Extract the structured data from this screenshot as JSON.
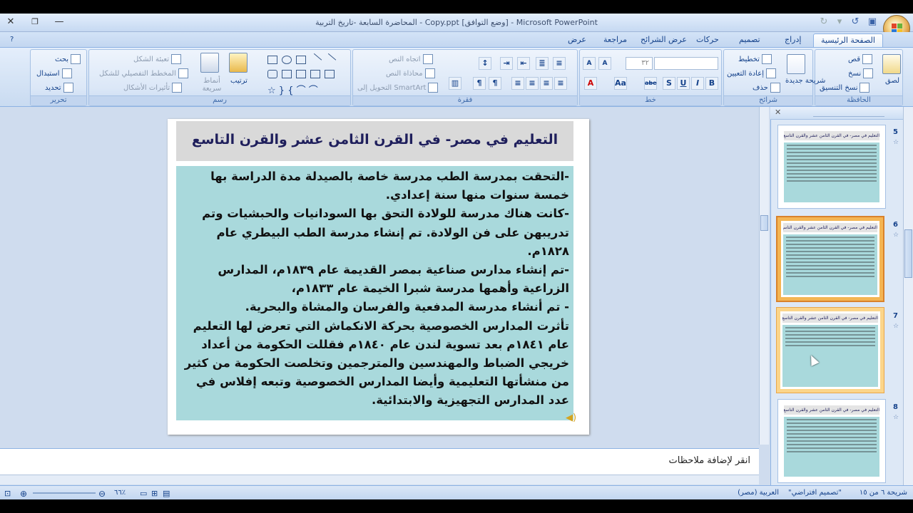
{
  "window": {
    "title": "المحاضرة السابعة -تاريخ التربية - Copy.ppt  [وضع التوافق] - Microsoft PowerPoint",
    "close": "✕",
    "restore": "❐",
    "minimize": "—"
  },
  "tabs": [
    "الصفحة الرئيسية",
    "إدراج",
    "تصميم",
    "حركات",
    "عرض الشرائح",
    "مراجعة",
    "عرض"
  ],
  "groups": {
    "clipboard": {
      "label": "الحافظة",
      "paste": "لصق",
      "cut": "قص",
      "copy": "نسخ",
      "format_painter": "نسخ التنسيق"
    },
    "slides": {
      "label": "شرائح",
      "new_slide": "شريحة جديدة",
      "layout": "تخطيط",
      "reset": "إعادة التعيين",
      "delete": "حذف"
    },
    "font": {
      "label": "خط",
      "size": "٣٢",
      "bold": "B",
      "italic": "I",
      "underline": "U",
      "shadow": "S",
      "strike": "abe"
    },
    "paragraph": {
      "label": "فقرة",
      "text_direction": "اتجاه النص",
      "align_text": "محاذاة النص",
      "smartart": "التحويل إلى SmartArt"
    },
    "drawing": {
      "label": "رسم",
      "arrange": "ترتيب",
      "quick_styles": "أنماط سريعة",
      "fill": "تعبئة الشكل",
      "outline": "المخطط التفصيلي للشكل",
      "effects": "تأثيرات الأشكال"
    },
    "editing": {
      "label": "تحرير",
      "find": "بحث",
      "replace": "استبدال",
      "select": "تحديد"
    }
  },
  "slide": {
    "title": "التعليم في مصر- في القرن الثامن عشر والقرن التاسع عشر",
    "paragraphs": [
      "-التحقت بمدرسة الطب مدرسة خاصة بالصيدلة مدة الدراسة بها خمسة سنوات منها سنة إعدادي.",
      "-كانت هناك مدرسة للولادة التحق بها السودانيات والحبشيات وتم تدريبهن على فن الولادة. تم إنشاء مدرسة الطب البيطري عام ١٨٢٨م.",
      "-تم إنشاء مدارس صناعية بمصر القديمة عام ١٨٣٩م، المدارس الزراعية  وأهمها مدرسة شبرا الخيمة عام ١٨٣٣م،",
      "- تم أنشاء مدرسة المدفعية والفرسان والمشاة والبحرية.",
      "تأثرت المدارس الخصوصية بحركة الانكماش التي تعرض لها التعليم عام ١٨٤١م بعد تسوية لندن عام ١٨٤٠م فقللت الحكومة من أعداد خريجي الضباط والمهندسين والمترجمين وتخلصت الحكومة من كثير من منشأتها التعليمية وأيضا المدارس الخصوصية وتبعه إفلاس في عدد المدارس التجهيزية والابتدائية."
    ]
  },
  "notes_placeholder": "انقر لإضافة ملاحظات",
  "thumbnails": [
    {
      "number": "5",
      "title": "التعليم في مصر- في القرن الثامن عشر والقرن التاسع عشر"
    },
    {
      "number": "6",
      "title": "التعليم في مصر- في القرن الثامن عشر والقرن التاسع عشر"
    },
    {
      "number": "7",
      "title": "التعليم في مصر- في القرن الثامن عشر والقرن التاسع عشر"
    },
    {
      "number": "8",
      "title": "التعليم في مصر- في القرن الثامن عشر والقرن التاسع عشر"
    }
  ],
  "status": {
    "slide_counter": "شريحة ٦ من ١٥",
    "theme": "\"تصميم افتراضي\"",
    "language": "العربية (مصر)",
    "zoom": "٦٦٪"
  }
}
